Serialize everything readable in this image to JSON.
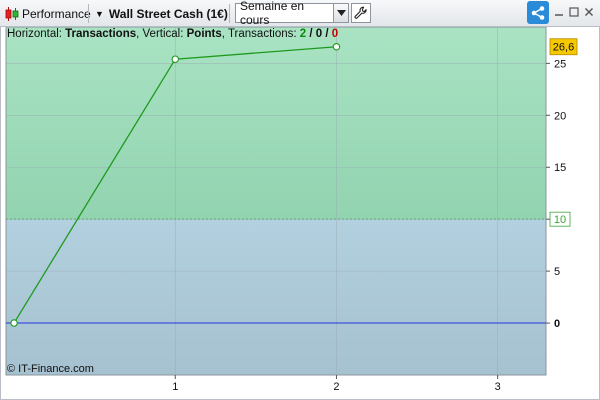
{
  "toolbar": {
    "app_label": "Performance",
    "instrument": "Wall Street Cash (1€)",
    "period": "Semaine en cours",
    "icons": {
      "app": "candlestick-icon",
      "instrument_dropdown": "caret-down-icon",
      "period_dropdown": "chevron-down-icon",
      "settings": "wrench-icon",
      "share": "share-icon",
      "minimize": "minimize-icon",
      "maximize": "maximize-icon",
      "close": "close-icon"
    }
  },
  "info": {
    "horizontal_label": "Horizontal: ",
    "horizontal_value": "Transactions",
    "vertical_label": ", Vertical: ",
    "vertical_value": "Points",
    "transactions_label": ", Transactions: ",
    "tx_win": "2",
    "tx_sep1": " / ",
    "tx_neutral": "0",
    "tx_sep2": " / ",
    "tx_loss": "0"
  },
  "copyright": "© IT-Finance.com",
  "colors": {
    "zone_top": "#a9e3c3",
    "zone_top_low": "#92d3b0",
    "zone_bottom": "#b2d0df",
    "zone_bottom_low": "#a6c1cf",
    "line": "#1e9a1e",
    "zero_line": "#2233dd",
    "grid": "#9aa8b0",
    "last_badge": "#f6c800",
    "threshold_text": "#3aa53a",
    "share_bg": "#2a8bd8"
  },
  "chart_data": {
    "type": "line",
    "x": [
      0,
      1,
      2
    ],
    "values": [
      0,
      25.4,
      26.6
    ],
    "xlim": [
      -0.05,
      3.3
    ],
    "ylim": [
      -5,
      28.5
    ],
    "x_ticks": [
      "1",
      "2",
      "3"
    ],
    "y_ticks": [
      "0",
      "5",
      "10",
      "15",
      "20",
      "25"
    ],
    "threshold": 10,
    "threshold_label": "10",
    "last_value_label": "26,6",
    "grid": true
  }
}
